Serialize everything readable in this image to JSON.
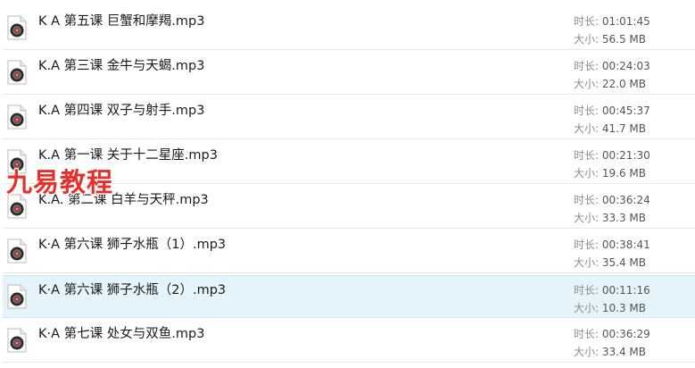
{
  "labels": {
    "duration": "时长: ",
    "size": "大小: "
  },
  "files": [
    {
      "name": "K A 第五课 巨蟹和摩羯.mp3",
      "duration": "01:01:45",
      "size": "56.5 MB",
      "selected": false
    },
    {
      "name": "K.A 第三课 金牛与天蝎.mp3",
      "duration": "00:24:03",
      "size": "22.0 MB",
      "selected": false
    },
    {
      "name": "K.A 第四课 双子与射手.mp3",
      "duration": "00:45:37",
      "size": "41.7 MB",
      "selected": false
    },
    {
      "name": "K.A 第一课 关于十二星座.mp3",
      "duration": "00:21:30",
      "size": "19.6 MB",
      "selected": false
    },
    {
      "name": "K.A. 第二课 白羊与天秤.mp3",
      "duration": "00:36:24",
      "size": "33.3 MB",
      "selected": false
    },
    {
      "name": "K·A 第六课 狮子水瓶（1）.mp3",
      "duration": "00:38:41",
      "size": "35.4 MB",
      "selected": false
    },
    {
      "name": "K·A 第六课 狮子水瓶（2）.mp3",
      "duration": "00:11:16",
      "size": "10.3 MB",
      "selected": true
    },
    {
      "name": "K·A 第七课 处女与双鱼.mp3",
      "duration": "00:36:29",
      "size": "33.4 MB",
      "selected": false
    }
  ],
  "watermark": {
    "text": "九易教程",
    "color": "#e8302b"
  },
  "colors": {
    "selected_bg": "#e5f3fb",
    "icon_disc": "#2a2a2a",
    "icon_center": "#c62828"
  }
}
